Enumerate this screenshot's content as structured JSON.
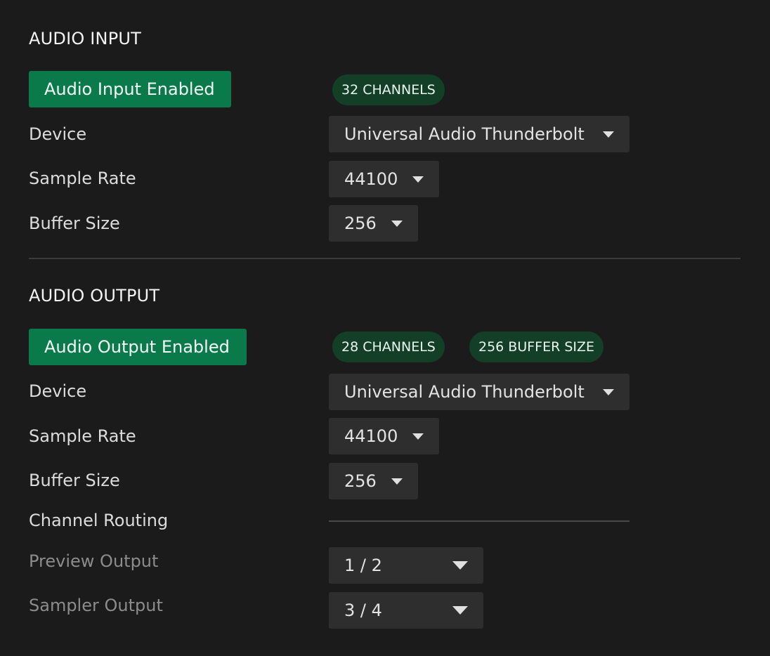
{
  "audio_input": {
    "title": "AUDIO INPUT",
    "enable_label": "Audio Input Enabled",
    "badges": [
      "32 CHANNELS"
    ],
    "device_label": "Device",
    "device_value": "Universal Audio Thunderbolt",
    "sample_rate_label": "Sample Rate",
    "sample_rate_value": "44100",
    "buffer_size_label": "Buffer Size",
    "buffer_size_value": "256"
  },
  "audio_output": {
    "title": "AUDIO OUTPUT",
    "enable_label": "Audio Output Enabled",
    "badges": [
      "28 CHANNELS",
      "256 BUFFER SIZE"
    ],
    "device_label": "Device",
    "device_value": "Universal Audio Thunderbolt",
    "sample_rate_label": "Sample Rate",
    "sample_rate_value": "44100",
    "buffer_size_label": "Buffer Size",
    "buffer_size_value": "256",
    "channel_routing_label": "Channel Routing",
    "preview_output_label": "Preview Output",
    "preview_output_value": "1 / 2",
    "sampler_output_label": "Sampler Output",
    "sampler_output_value": "3 / 4"
  },
  "colors": {
    "background": "#1b1b1b",
    "accent_green": "#0a7a4a",
    "badge_green": "#133f27",
    "select_bg": "#2e2e2e"
  },
  "icons": {
    "dropdown": "chevron-down-icon"
  }
}
